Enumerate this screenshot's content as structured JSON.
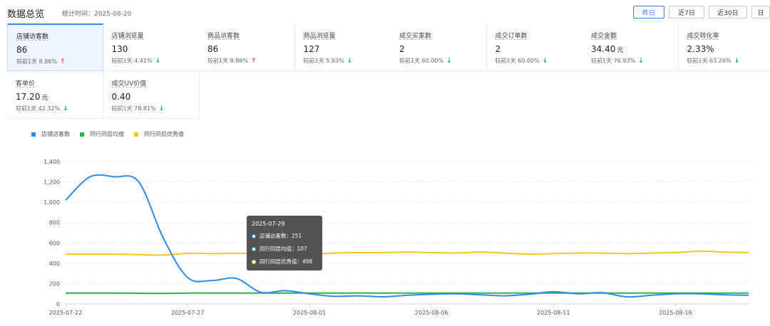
{
  "header": {
    "title": "数据总览",
    "stat_time": "统计时间：2025-08-20",
    "ranges": [
      "昨日",
      "近7日",
      "近30日",
      "日"
    ]
  },
  "metrics": [
    {
      "label": "店铺访客数",
      "value": "86",
      "unit": "",
      "compare": "较前1天 8.86%",
      "trend": "up",
      "active": true
    },
    {
      "label": "店铺浏览量",
      "value": "130",
      "unit": "",
      "compare": "较前1天 4.41%",
      "trend": "down"
    },
    {
      "label": "商品访客数",
      "value": "86",
      "unit": "",
      "compare": "较前1天 8.86%",
      "trend": "up"
    },
    {
      "label": "商品浏览量",
      "value": "127",
      "unit": "",
      "compare": "较前1天 5.93%",
      "trend": "down"
    },
    {
      "label": "成交买家数",
      "value": "2",
      "unit": "",
      "compare": "较前1天 60.00%",
      "trend": "down"
    },
    {
      "label": "成交订单数",
      "value": "2",
      "unit": "",
      "compare": "较前1天 60.00%",
      "trend": "down"
    },
    {
      "label": "成交金额",
      "value": "34.40",
      "unit": "元",
      "compare": "较前1天 76.93%",
      "trend": "down"
    },
    {
      "label": "成交转化率",
      "value": "2.33%",
      "unit": "",
      "compare": "较前1天 63.26%",
      "trend": "down"
    },
    {
      "label": "客单价",
      "value": "17.20",
      "unit": "元",
      "compare": "较前1天 42.32%",
      "trend": "down"
    },
    {
      "label": "成交UV价值",
      "value": "0.40",
      "unit": "",
      "compare": "较前1天 78.81%",
      "trend": "down"
    }
  ],
  "colors": {
    "accent": "#3b7de0",
    "visitors": "#2d8ceb",
    "peer_avg": "#2fb24c",
    "peer_excellent": "#fac51c",
    "up": "#f04a3a",
    "down": "#1fa85e"
  },
  "tooltip": {
    "date": "2025-07-29",
    "rows": [
      {
        "label": "店铺访客数：",
        "value": "251"
      },
      {
        "label": "同行同层均值：",
        "value": "107"
      },
      {
        "label": "同行同层优秀值：",
        "value": "498"
      }
    ]
  },
  "chart_data": {
    "type": "line",
    "x": [
      "2025-07-22",
      "2025-07-23",
      "2025-07-24",
      "2025-07-25",
      "2025-07-26",
      "2025-07-27",
      "2025-07-28",
      "2025-07-29",
      "2025-07-30",
      "2025-07-31",
      "2025-08-01",
      "2025-08-02",
      "2025-08-03",
      "2025-08-04",
      "2025-08-05",
      "2025-08-06",
      "2025-08-07",
      "2025-08-08",
      "2025-08-09",
      "2025-08-10",
      "2025-08-11",
      "2025-08-12",
      "2025-08-13",
      "2025-08-14",
      "2025-08-15",
      "2025-08-16",
      "2025-08-17",
      "2025-08-18",
      "2025-08-19"
    ],
    "x_tick_labels": [
      "2025-07-22",
      "2025-07-27",
      "2025-08-01",
      "2025-08-06",
      "2025-08-11",
      "2025-08-16"
    ],
    "ylim": [
      0,
      1400
    ],
    "y_ticks": [
      0,
      200,
      400,
      600,
      800,
      1000,
      1200,
      1400
    ],
    "y_tick_labels": [
      "0",
      "200",
      "400",
      "600",
      "800",
      "1,000",
      "1,200",
      "1,400"
    ],
    "grid": true,
    "legend_position": "top-left",
    "series": [
      {
        "name": "店铺访客数",
        "values": [
          1020,
          1250,
          1250,
          1200,
          650,
          260,
          230,
          251,
          115,
          130,
          100,
          75,
          80,
          70,
          85,
          95,
          100,
          90,
          80,
          95,
          120,
          100,
          110,
          70,
          85,
          100,
          100,
          90,
          85
        ]
      },
      {
        "name": "同行同层均值",
        "values": [
          107,
          107,
          107,
          105,
          103,
          107,
          107,
          107,
          107,
          107,
          107,
          107,
          107,
          107,
          107,
          107,
          107,
          107,
          107,
          107,
          107,
          107,
          107,
          107,
          107,
          107,
          107,
          107,
          107
        ]
      },
      {
        "name": "同行同层优秀值",
        "values": [
          490,
          490,
          490,
          485,
          480,
          498,
          495,
          498,
          492,
          490,
          490,
          500,
          505,
          505,
          510,
          505,
          500,
          510,
          500,
          490,
          495,
          500,
          500,
          495,
          500,
          505,
          520,
          510,
          505
        ]
      }
    ]
  }
}
